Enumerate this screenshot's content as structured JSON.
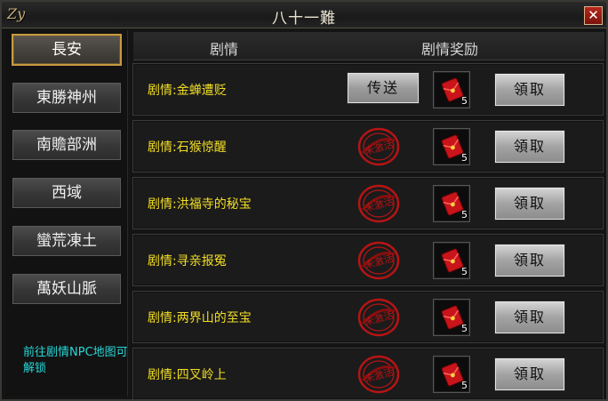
{
  "window": {
    "title": "八十一難",
    "logo": "Zy"
  },
  "sidebar": {
    "regions": [
      {
        "label": "長安",
        "active": true
      },
      {
        "label": "東勝神州",
        "active": false
      },
      {
        "label": "南贍部洲",
        "active": false
      },
      {
        "label": "西域",
        "active": false
      },
      {
        "label": "蠻荒凍土",
        "active": false
      },
      {
        "label": "萬妖山脈",
        "active": false
      }
    ],
    "hint": "前往剧情NPC地图可解锁"
  },
  "header": {
    "story": "剧情",
    "reward": "剧情奖励"
  },
  "rows": [
    {
      "name": "剧情:金蝉遭贬",
      "state": "teleport",
      "teleport_label": "传送",
      "reward_icon": "red-envelope-icon",
      "reward_qty": "5",
      "claim_label": "領取"
    },
    {
      "name": "剧情:石猴惊醒",
      "state": "locked",
      "reward_icon": "red-envelope-icon",
      "reward_qty": "5",
      "claim_label": "領取"
    },
    {
      "name": "剧情:洪福寺的秘宝",
      "state": "locked",
      "reward_icon": "red-envelope-icon",
      "reward_qty": "5",
      "claim_label": "領取"
    },
    {
      "name": "剧情:寻亲报冤",
      "state": "locked",
      "reward_icon": "red-envelope-icon",
      "reward_qty": "5",
      "claim_label": "領取"
    },
    {
      "name": "剧情:两界山的至宝",
      "state": "locked",
      "reward_icon": "red-envelope-icon",
      "reward_qty": "5",
      "claim_label": "領取"
    },
    {
      "name": "剧情:四叉岭上",
      "state": "locked",
      "reward_icon": "red-envelope-icon",
      "reward_qty": "5",
      "claim_label": "領取"
    }
  ],
  "stamp_text": "未激活",
  "colors": {
    "story_text": "#f2de24",
    "hint_text": "#28d6d6",
    "active_border": "#c79a40",
    "stamp_red": "#b81414"
  }
}
